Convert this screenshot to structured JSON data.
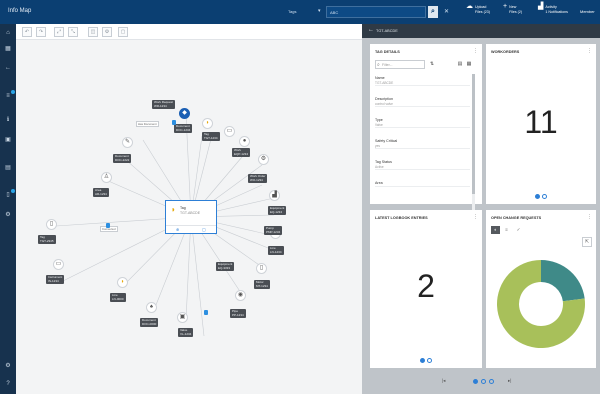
{
  "app": {
    "title": "Info Map"
  },
  "topbar": {
    "selector_value": "Tags",
    "search_text": "ABC",
    "actions": [
      {
        "icon": "cloud-upload-icon",
        "line1": "Upload",
        "line2": "Files (23)"
      },
      {
        "icon": "plus-icon",
        "line1": "New",
        "line2": "Files (2)"
      },
      {
        "icon": "chart-icon",
        "line1": "Activity",
        "line2": "1 Notifications"
      }
    ],
    "user": "Member"
  },
  "toolbar": {
    "buttons": [
      "undo-icon",
      "redo-icon",
      "expand-icon",
      "collapse-icon",
      "layout-icon",
      "settings-icon"
    ]
  },
  "graph": {
    "center": {
      "line1": "Tag",
      "line2": "TGT-ABCDE"
    },
    "nodes": [
      {
        "label1": "Document",
        "label2": "DOC-1234"
      },
      {
        "label1": "Tag",
        "label2": "TGT-1234"
      },
      {
        "label1": "Work",
        "label2": "EQP-1234"
      },
      {
        "label1": "Work Order",
        "label2": "WO-1234"
      },
      {
        "label1": "Equipment",
        "label2": "EQ-1234"
      },
      {
        "label1": "Line",
        "label2": "LN-1234"
      },
      {
        "label1": "Motor",
        "label2": "MT-1234"
      },
      {
        "label1": "Pipe",
        "label2": "PP-1234"
      },
      {
        "label1": "Valve",
        "label2": "VL-1234"
      },
      {
        "label1": "Document",
        "label2": "DOC-0000"
      },
      {
        "label1": "Line",
        "label2": "LN-0000"
      },
      {
        "label1": "Instrument",
        "label2": "IN-1234"
      },
      {
        "label1": "Tag",
        "label2": "TGT-2345"
      },
      {
        "label1": "Area",
        "label2": "AR-1234"
      },
      {
        "label1": "Document",
        "label2": "DOC-2222"
      },
      {
        "label1": "Pump",
        "label2": "PMP-1234"
      },
      {
        "label1": "Equipment",
        "label2": "EQ-3333"
      },
      {
        "label1": "Work Request",
        "label2": "WR-1234"
      }
    ],
    "link_tags": [
      "Has Document",
      "Connected"
    ]
  },
  "panel": {
    "header": "TGT-ABCDE",
    "tag_details": {
      "title": "TAG DETAILS",
      "filter_placeholder": "Filter...",
      "fields": [
        {
          "label": "Name",
          "value": "TGT-ABCDE"
        },
        {
          "label": "Description",
          "value": "control valve"
        },
        {
          "label": "Type",
          "value": "Valve"
        },
        {
          "label": "Safety Critical",
          "value": "yes"
        },
        {
          "label": "Tag Status",
          "value": "Active"
        },
        {
          "label": "Area",
          "value": ""
        }
      ]
    },
    "workorders": {
      "title": "WORKORDERS",
      "count": "11"
    },
    "logbook": {
      "title": "LATEST LOGBOOK ENTRIES",
      "count": "2"
    },
    "change_requests": {
      "title": "OPEN CHANGE REQUESTS",
      "chips": [
        "chart-pie-icon",
        "list-icon",
        "check-icon"
      ]
    }
  },
  "chart_data": {
    "type": "pie",
    "title": "",
    "donut": true,
    "values": [
      23,
      77
    ],
    "colors": [
      "#3f8a88",
      "#a8c05a"
    ]
  }
}
